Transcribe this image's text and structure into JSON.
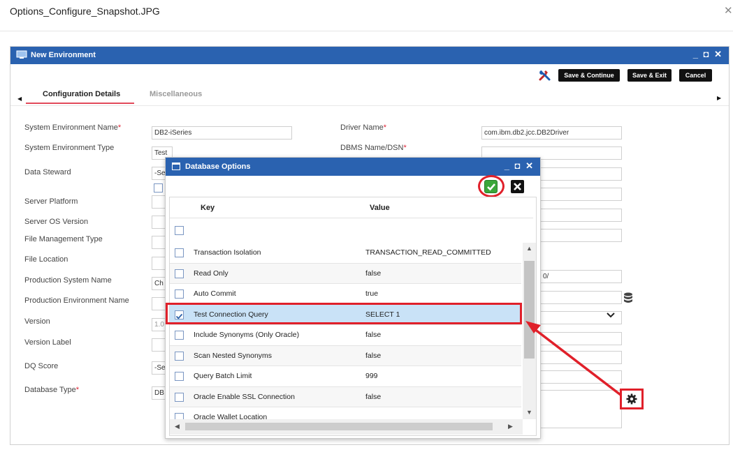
{
  "viewer": {
    "filename": "Options_Configure_Snapshot.JPG"
  },
  "window": {
    "title": "New Environment",
    "controls": "_ ◘ ✕",
    "save_continue": "Save & Continue",
    "save_exit": "Save & Exit",
    "cancel": "Cancel"
  },
  "tabs": {
    "config": "Configuration Details",
    "misc": "Miscellaneous"
  },
  "form": {
    "left": [
      {
        "label": "System Environment Name",
        "required": true,
        "value": "DB2-iSeries"
      },
      {
        "label": "System Environment Type",
        "required": false,
        "value": "Test"
      },
      {
        "label": "Data Steward",
        "required": false,
        "value": "-Se"
      },
      {
        "label": "Server Platform",
        "required": false,
        "value": ""
      },
      {
        "label": "Server OS Version",
        "required": false,
        "value": ""
      },
      {
        "label": "File Management Type",
        "required": false,
        "value": ""
      },
      {
        "label": "File Location",
        "required": false,
        "value": ""
      },
      {
        "label": "Production System Name",
        "required": false,
        "value": "Ch"
      },
      {
        "label": "Production Environment Name",
        "required": false,
        "value": ""
      },
      {
        "label": "Version",
        "required": false,
        "value": "1.0"
      },
      {
        "label": "Version Label",
        "required": false,
        "value": ""
      },
      {
        "label": "DQ Score",
        "required": false,
        "value": "-Se"
      },
      {
        "label": "Database Type",
        "required": true,
        "value": "DB"
      }
    ],
    "right": [
      {
        "label": "Driver Name",
        "required": true,
        "value": "com.ibm.db2.jcc.DB2Driver"
      },
      {
        "label": "DBMS Name/DSN",
        "required": true,
        "value": ""
      }
    ],
    "partial_value": "0/"
  },
  "modal": {
    "title": "Database Options",
    "controls": "_ ◘ ✕",
    "col_key": "Key",
    "col_value": "Value",
    "rows": [
      {
        "key": "Transaction Isolation",
        "value": "TRANSACTION_READ_COMMITTED",
        "checked": false
      },
      {
        "key": "Read Only",
        "value": "false",
        "checked": false
      },
      {
        "key": "Auto Commit",
        "value": "true",
        "checked": false
      },
      {
        "key": "Test Connection Query",
        "value": "SELECT 1",
        "checked": true
      },
      {
        "key": "Include Synonyms (Only Oracle)",
        "value": "false",
        "checked": false
      },
      {
        "key": "Scan Nested Synonyms",
        "value": "false",
        "checked": false
      },
      {
        "key": "Query Batch Limit",
        "value": "999",
        "checked": false
      },
      {
        "key": "Oracle Enable SSL Connection",
        "value": "false",
        "checked": false
      },
      {
        "key": "Oracle Wallet Location",
        "value": "",
        "checked": false
      }
    ]
  },
  "colors": {
    "titlebar": "#2a62b0",
    "highlight": "#e0202a",
    "selected_row": "#c9e2f7",
    "tab_underline": "#e24a5a"
  },
  "icons": [
    "tools-icon",
    "database-icon",
    "chevron-down-icon",
    "gear-icon",
    "check-icon",
    "close-icon",
    "window-icon",
    "monitor-icon"
  ]
}
